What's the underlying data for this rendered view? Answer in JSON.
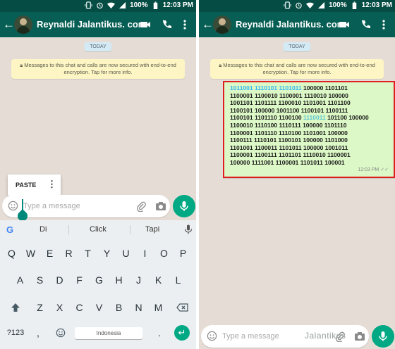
{
  "status": {
    "battery": "100%",
    "time": "12:03 PM"
  },
  "chat": {
    "contact_name": "Reynaldi Jalantikus. com",
    "date_chip": "TODAY",
    "encryption_notice": "Messages to this chat and calls are now secured with end-to-end encryption. Tap for more info."
  },
  "input": {
    "placeholder": "Type a message"
  },
  "paste_popup": {
    "label": "PASTE"
  },
  "keyboard": {
    "suggestions": [
      "Di",
      "Click",
      "Tapi"
    ],
    "row1": [
      "Q",
      "W",
      "E",
      "R",
      "T",
      "Y",
      "U",
      "I",
      "O",
      "P"
    ],
    "row2": [
      "A",
      "S",
      "D",
      "F",
      "G",
      "H",
      "J",
      "K",
      "L"
    ],
    "row3": [
      "Z",
      "X",
      "C",
      "V",
      "B",
      "N",
      "M"
    ],
    "symbols_key": "?123",
    "comma_key": ",",
    "period_key": ".",
    "space_label": "Indonesia"
  },
  "message": {
    "line1_hl": "1011001 1110101 1101011",
    "line1_rest": " 100000 1101101",
    "line2": "1100001 1100010 1100001 1110010 100000",
    "line3": "1001101 1101111 1100010 1101001 1101100",
    "line4": "1100101 100000 1001100 1100101 1100111",
    "line5_a": "1100101 1101110 1100100 ",
    "line5_hl": "1110011",
    "line5_b": " 101100 100000",
    "line6": "1100010 1110100 1110111 100000 1101110",
    "line7": "1100001 1101110 1110100 1101001 100000",
    "line8": "1100111 1110101 1100101 100000 1101000",
    "line9": "1101001 1100011 1101011 100000 1001011",
    "line10": "1100001 1100111 1101101 1110010 1100001",
    "line11": "100000 1111001 1100001 1101011 100001",
    "time": "12:03 PM"
  },
  "watermark": "Jalantikus",
  "colors": {
    "header": "#075e54",
    "statusbar": "#054d44",
    "accent": "#00a884",
    "bubble": "#dcf8c6",
    "highlight_border": "#e02020",
    "chat_bg": "#e5ddd5"
  }
}
